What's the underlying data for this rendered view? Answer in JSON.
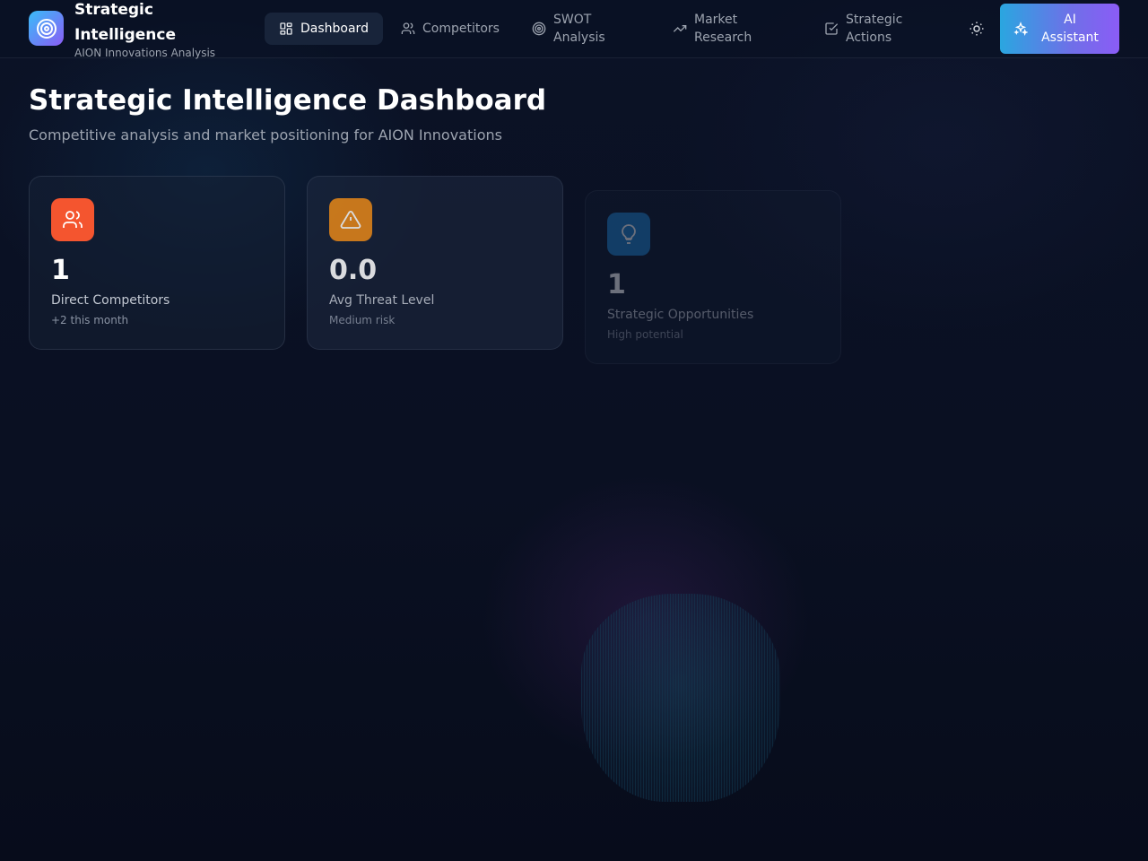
{
  "header": {
    "brand_title": "Strategic Intelligence",
    "brand_subtitle": "AION Innovations Analysis",
    "nav": [
      {
        "label": "Dashboard",
        "icon": "dashboard-icon",
        "active": true
      },
      {
        "label": "Competitors",
        "icon": "users-icon",
        "active": false
      },
      {
        "label": "SWOT Analysis",
        "icon": "target-icon",
        "active": false
      },
      {
        "label": "Market Research",
        "icon": "trending-up-icon",
        "active": false
      },
      {
        "label": "Strategic Actions",
        "icon": "check-square-icon",
        "active": false
      }
    ],
    "theme_toggle_icon": "sun-icon",
    "ai_button_label": "AI Assistant",
    "ai_button_icon": "sparkles-icon"
  },
  "page": {
    "title": "Strategic Intelligence Dashboard",
    "subtitle": "Competitive analysis and market positioning for AION Innovations"
  },
  "stats": [
    {
      "value": "1",
      "label": "Direct Competitors",
      "note": "+2 this month",
      "icon": "users-icon",
      "color": "#f4552f"
    },
    {
      "value": "0.0",
      "label": "Avg Threat Level",
      "note": "Medium risk",
      "icon": "alert-triangle-icon",
      "color": "#e8891a"
    },
    {
      "value": "1",
      "label": "Strategic Opportunities",
      "note": "High potential",
      "icon": "lightbulb-icon",
      "color": "#1f7fc9"
    }
  ],
  "colors": {
    "background": "#0a1022",
    "accent_blue": "#38bdf8",
    "accent_purple": "#8b5cf6"
  }
}
